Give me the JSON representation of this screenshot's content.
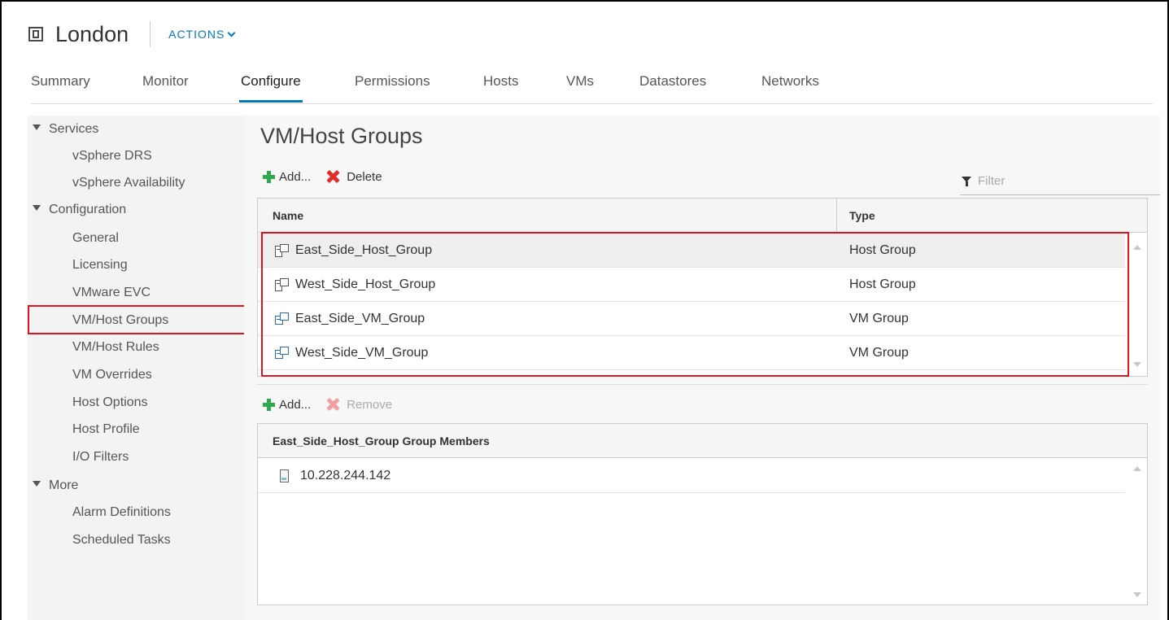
{
  "header": {
    "title": "London",
    "actions_label": "ACTIONS"
  },
  "tabs": [
    {
      "label": "Summary",
      "active": false
    },
    {
      "label": "Monitor",
      "active": false
    },
    {
      "label": "Configure",
      "active": true
    },
    {
      "label": "Permissions",
      "active": false
    },
    {
      "label": "Hosts",
      "active": false
    },
    {
      "label": "VMs",
      "active": false
    },
    {
      "label": "Datastores",
      "active": false
    },
    {
      "label": "Networks",
      "active": false
    }
  ],
  "sidebar": {
    "sections": [
      {
        "label": "Services",
        "items": [
          "vSphere DRS",
          "vSphere Availability"
        ]
      },
      {
        "label": "Configuration",
        "items": [
          "General",
          "Licensing",
          "VMware EVC",
          "VM/Host Groups",
          "VM/Host Rules",
          "VM Overrides",
          "Host Options",
          "Host Profile",
          "I/O Filters"
        ]
      },
      {
        "label": "More",
        "items": [
          "Alarm Definitions",
          "Scheduled Tasks"
        ]
      }
    ],
    "selected_item": "VM/Host Groups"
  },
  "main": {
    "title": "VM/Host Groups",
    "toolbar": {
      "add_label": "Add...",
      "delete_label": "Delete"
    },
    "filter_placeholder": "Filter",
    "groups_table": {
      "columns": [
        "Name",
        "Type"
      ],
      "rows": [
        {
          "name": "East_Side_Host_Group",
          "type": "Host Group",
          "icon": "host-group-icon",
          "selected": true
        },
        {
          "name": "West_Side_Host_Group",
          "type": "Host Group",
          "icon": "host-group-icon",
          "selected": false
        },
        {
          "name": "East_Side_VM_Group",
          "type": "VM Group",
          "icon": "vm-group-icon",
          "selected": false
        },
        {
          "name": "West_Side_VM_Group",
          "type": "VM Group",
          "icon": "vm-group-icon",
          "selected": false
        }
      ]
    },
    "members_toolbar": {
      "add_label": "Add...",
      "remove_label": "Remove"
    },
    "members_table": {
      "column": "East_Side_Host_Group Group Members",
      "rows": [
        {
          "name": "10.228.244.142",
          "icon": "host-icon"
        }
      ]
    }
  },
  "colors": {
    "accent": "#0079b8",
    "highlight_box": "#e0141e",
    "add_green": "#2fa84f",
    "delete_red": "#e12a2a"
  }
}
